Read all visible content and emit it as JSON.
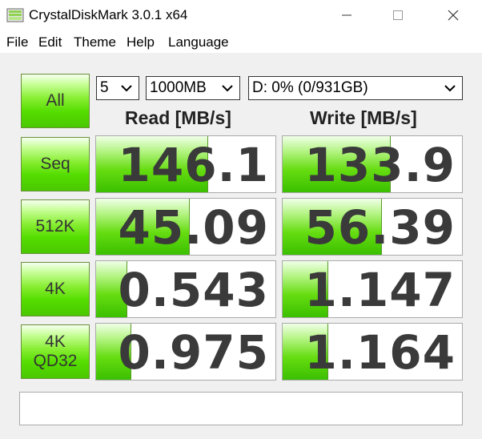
{
  "window": {
    "title": "CrystalDiskMark 3.0.1 x64"
  },
  "menu": [
    "File",
    "Edit",
    "Theme",
    "Help",
    "Language"
  ],
  "controls": {
    "all_label": "All",
    "runs": "5",
    "size": "1000MB",
    "drive": "D: 0% (0/931GB)"
  },
  "headers": {
    "read": "Read [MB/s]",
    "write": "Write [MB/s]"
  },
  "rows": [
    {
      "label": "Seq",
      "read": "146.1",
      "write": "133.9",
      "read_fill": 0.62,
      "write_fill": 0.6
    },
    {
      "label": "512K",
      "read": "45.09",
      "write": "56.39",
      "read_fill": 0.52,
      "write_fill": 0.55
    },
    {
      "label": "4K",
      "read": "0.543",
      "write": "1.147",
      "read_fill": 0.17,
      "write_fill": 0.25
    },
    {
      "label_line1": "4K",
      "label_line2": "QD32",
      "read": "0.975",
      "write": "1.164",
      "read_fill": 0.19,
      "write_fill": 0.25
    }
  ],
  "status": "",
  "colors": {
    "accent_green": "#55dd00",
    "value_text": "#3a3a3a"
  }
}
